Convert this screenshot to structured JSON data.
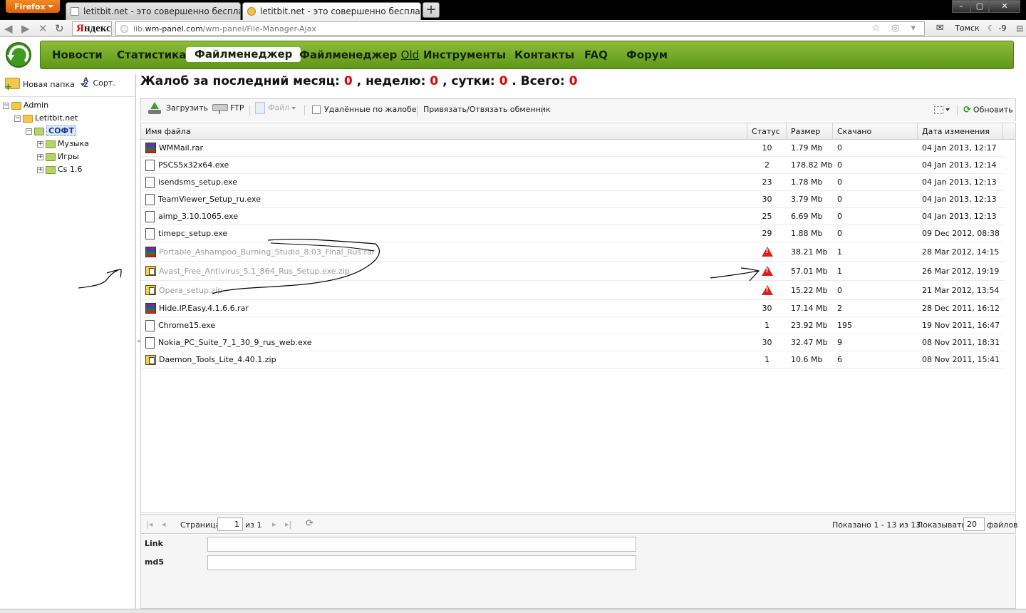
{
  "browser": {
    "firefox_label": "Firefox",
    "tabs": [
      {
        "title": "letitbit.net - это совершенно бесплат..."
      },
      {
        "title": "letitbit.net - это совершенно бесплат..."
      }
    ],
    "new_tab": "+",
    "search_logo_first": "Я",
    "search_logo_rest": "ндекс",
    "url_prefix": "lib.",
    "url_host": "wm-panel.com",
    "url_path": "/wm-panel/File-Manager-Ajax",
    "weather_city": "Томск",
    "weather_temp": "-9"
  },
  "nav": {
    "items": [
      {
        "label": "Новости"
      },
      {
        "label": "Статистика"
      },
      {
        "label": "Файлменеджер"
      },
      {
        "label": "Файлменеджер "
      },
      {
        "label": "Инструменты"
      },
      {
        "label": "Контакты"
      },
      {
        "label": "FAQ"
      },
      {
        "label": "Форум"
      }
    ],
    "old_label": "Old"
  },
  "sidebar": {
    "new_folder": "Новая папка",
    "sort": "Сорт.",
    "tree": [
      {
        "label": "Admin",
        "toggle": "−"
      },
      {
        "label": "Letitbit.net",
        "toggle": "−"
      },
      {
        "label": "СОФТ",
        "toggle": "−"
      },
      {
        "label": "Музыка",
        "toggle": "+"
      },
      {
        "label": "Игры",
        "toggle": "+"
      },
      {
        "label": "Cs 1.6",
        "toggle": "+"
      }
    ]
  },
  "complaints": {
    "prefix": "Жалоб за последний месяц:",
    "month": "0",
    "week_label": ", неделю:",
    "week": "0",
    "day_label": ", сутки:",
    "day": "0",
    "total_label": ". Всего:",
    "total": "0"
  },
  "toolbar": {
    "upload": "Загрузить",
    "ftp": "FTP",
    "file": "Файл",
    "deleted": "Удалённые по жалобе",
    "bind": "Привязать/Отвязать обменник",
    "refresh": "Обновить"
  },
  "grid": {
    "headers": {
      "name": "Имя файла",
      "status": "Статус",
      "size": "Размер",
      "downloads": "Скачано",
      "modified": "Дата изменения"
    },
    "rows": [
      {
        "name": "WMMail.rar",
        "type": "rar",
        "status": "10",
        "size": "1.79 Mb",
        "downloads": "0",
        "modified": "04 Jan 2013, 12:17",
        "blocked": false
      },
      {
        "name": "PSCS5x32x64.exe",
        "type": "exe",
        "status": "2",
        "size": "178.82 Mb",
        "downloads": "0",
        "modified": "04 Jan 2013, 12:14",
        "blocked": false
      },
      {
        "name": "isendsms_setup.exe",
        "type": "exe",
        "status": "23",
        "size": "1.78 Mb",
        "downloads": "0",
        "modified": "04 Jan 2013, 12:13",
        "blocked": false
      },
      {
        "name": "TeamViewer_Setup_ru.exe",
        "type": "exe",
        "status": "30",
        "size": "3.79 Mb",
        "downloads": "0",
        "modified": "04 Jan 2013, 12:13",
        "blocked": false
      },
      {
        "name": "aimp_3.10.1065.exe",
        "type": "exe",
        "status": "25",
        "size": "6.69 Mb",
        "downloads": "0",
        "modified": "04 Jan 2013, 12:13",
        "blocked": false
      },
      {
        "name": "timepc_setup.exe",
        "type": "exe",
        "status": "29",
        "size": "1.88 Mb",
        "downloads": "0",
        "modified": "09 Dec 2012, 08:38",
        "blocked": false
      },
      {
        "name": "Portable_Ashampoo_Burning_Studio_8.03_Final_Rus.rar",
        "type": "rar",
        "status": "",
        "size": "38.21 Mb",
        "downloads": "1",
        "modified": "28 Mar 2012, 14:15",
        "blocked": true
      },
      {
        "name": "Avast_Free_Antivirus_5.1_864_Rus_Setup.exe.zip",
        "type": "zip",
        "status": "",
        "size": "57.01 Mb",
        "downloads": "1",
        "modified": "26 Mar 2012, 19:19",
        "blocked": true
      },
      {
        "name": "Opera_setup.zip",
        "type": "zip",
        "status": "",
        "size": "15.22 Mb",
        "downloads": "0",
        "modified": "21 Mar 2012, 13:54",
        "blocked": true
      },
      {
        "name": "Hide.IP.Easy.4.1.6.6.rar",
        "type": "rar",
        "status": "30",
        "size": "17.14 Mb",
        "downloads": "2",
        "modified": "28 Dec 2011, 16:12",
        "blocked": false
      },
      {
        "name": "Chrome15.exe",
        "type": "exe",
        "status": "1",
        "size": "23.92 Mb",
        "downloads": "195",
        "modified": "19 Nov 2011, 16:47",
        "blocked": false
      },
      {
        "name": "Nokia_PC_Suite_7_1_30_9_rus_web.exe",
        "type": "exe",
        "status": "30",
        "size": "32.47 Mb",
        "downloads": "9",
        "modified": "08 Nov 2011, 18:31",
        "blocked": false
      },
      {
        "name": "Daemon_Tools_Lite_4.40.1.zip",
        "type": "zip",
        "status": "1",
        "size": "10.6 Mb",
        "downloads": "6",
        "modified": "08 Nov 2011, 15:41",
        "blocked": false
      }
    ]
  },
  "pager": {
    "page_label": "Страница",
    "page": "1",
    "of_label": "из 1",
    "shown": "Показано 1 - 13 из 13",
    "show_label": "Показывать",
    "per_page": "20",
    "files_label": "файлов"
  },
  "form": {
    "link_label": "Link",
    "md5_label": "md5"
  }
}
